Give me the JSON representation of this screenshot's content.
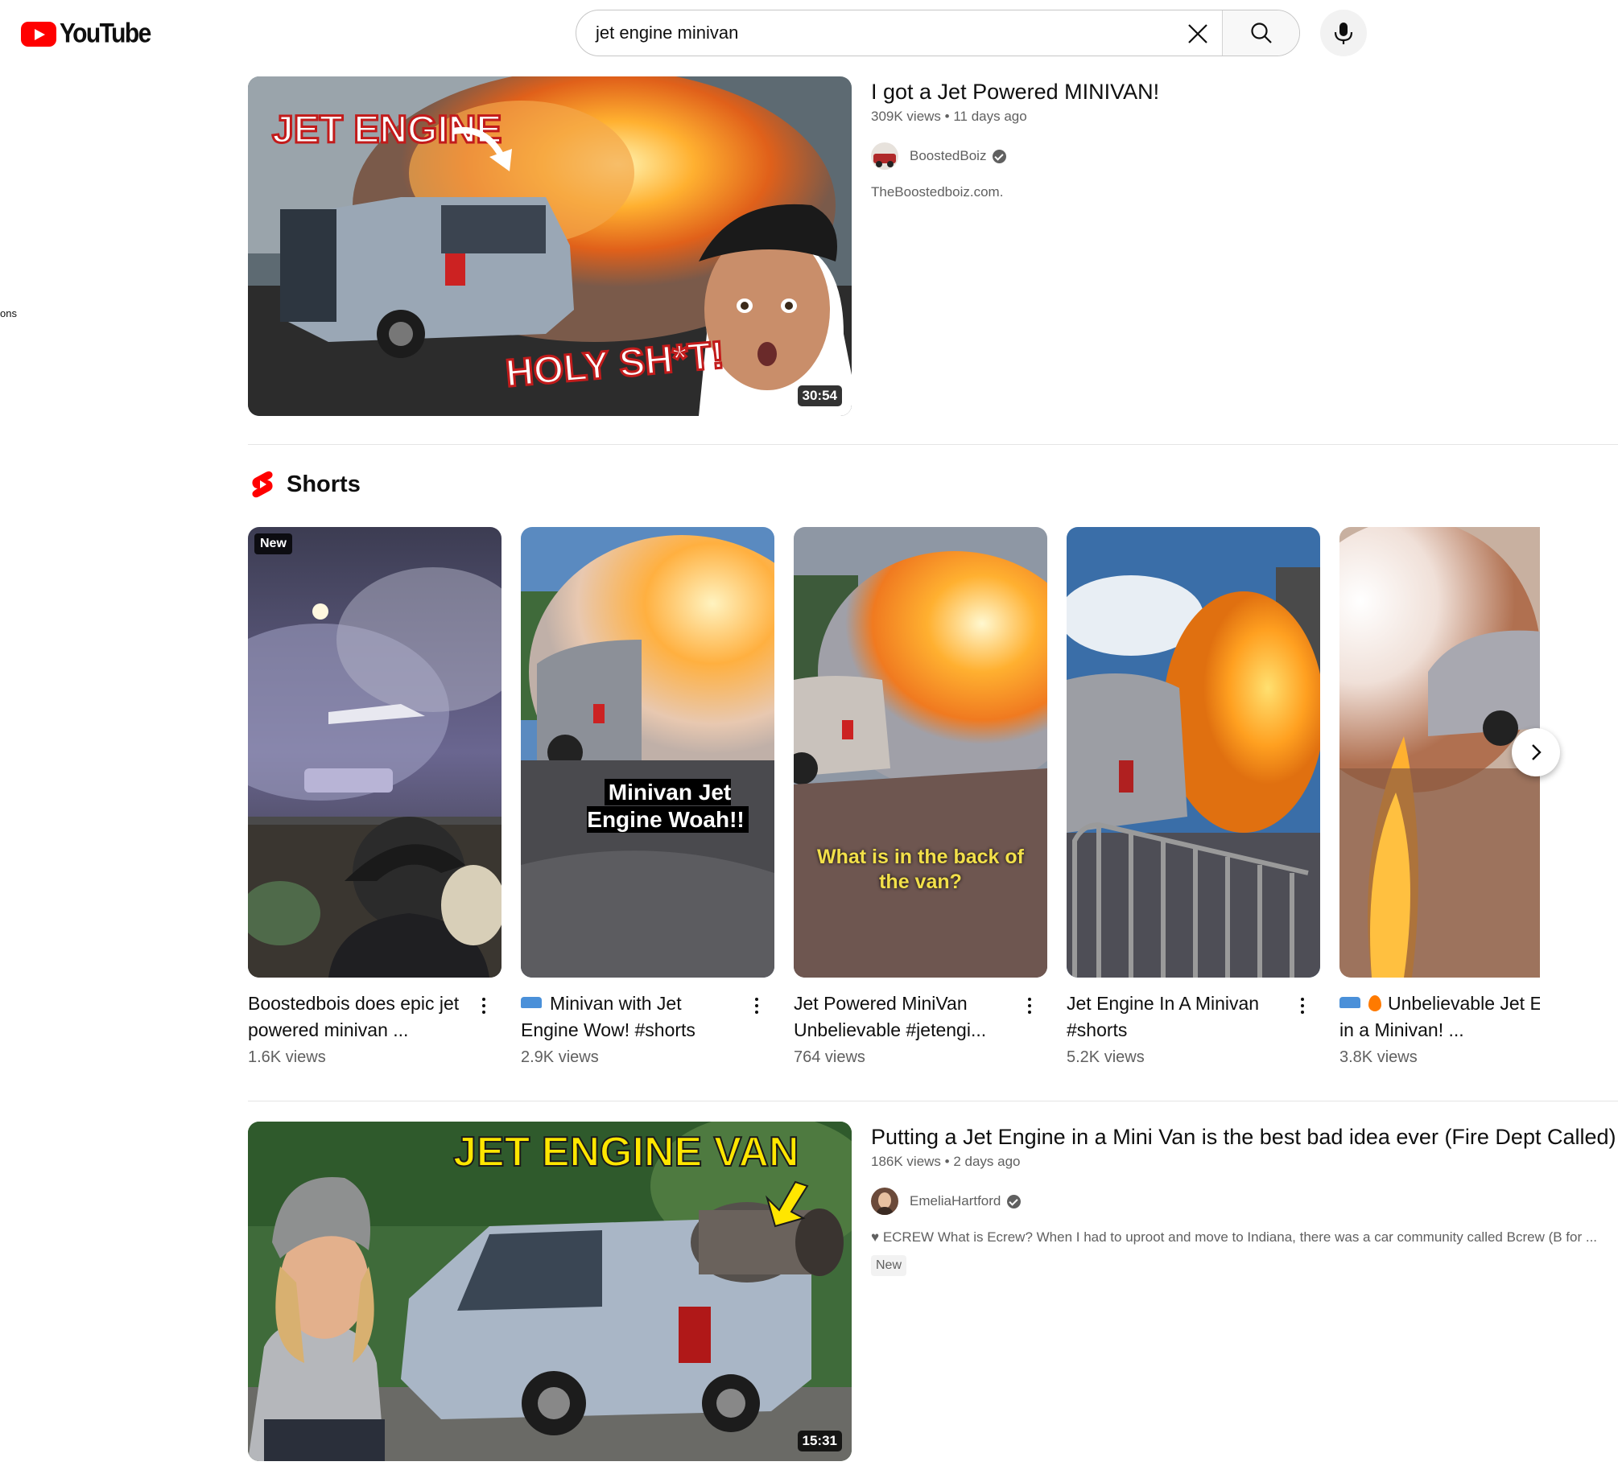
{
  "header": {
    "logo_text": "YouTube",
    "search_value": "jet engine minivan"
  },
  "sidebar_stub": "ons",
  "videos": [
    {
      "title": "I got a Jet Powered MINIVAN!",
      "meta": "309K views • 11 days ago",
      "channel": "BoostedBoiz",
      "description": "TheBoostedboiz.com.",
      "duration": "30:54",
      "thumb_text_1": "JET ENGINE",
      "thumb_text_2": "HOLY SH*T!"
    },
    {
      "title": "Putting a Jet Engine in a Mini Van is the best bad idea ever (Fire Dept Called)",
      "meta": "186K views • 2 days ago",
      "channel": "EmeliaHartford",
      "description": "♥ ECREW What is Ecrew? When I had to uproot and move to Indiana, there was a car community called Bcrew (B for ...",
      "badge": "New",
      "duration": "15:31",
      "thumb_text_1": "JET ENGINE VAN"
    }
  ],
  "shorts": {
    "label": "Shorts",
    "items": [
      {
        "title": "Boostedbois does epic jet powered minivan ...",
        "views": "1.6K views",
        "badge": "New"
      },
      {
        "title": "Minivan with Jet Engine Wow! #shorts",
        "views": "2.9K views",
        "caption": "Minivan Jet Engine Woah!!"
      },
      {
        "title": "Jet Powered MiniVan Unbelievable #jetengi...",
        "views": "764 views",
        "caption": "What is in the back of the van?"
      },
      {
        "title": "Jet Engine In A Minivan #shorts",
        "views": "5.2K views"
      },
      {
        "title": "Unbelievable Jet Engine in a Minivan! ...",
        "views": "3.8K views"
      }
    ]
  },
  "colors": {
    "brand": "#ff0000",
    "text": "#0f0f0f",
    "muted": "#606060"
  },
  "icons": [
    "youtube-logo-icon",
    "close-icon",
    "search-icon",
    "mic-icon",
    "shorts-icon",
    "verified-icon",
    "more-vert-icon",
    "chevron-right-icon"
  ]
}
